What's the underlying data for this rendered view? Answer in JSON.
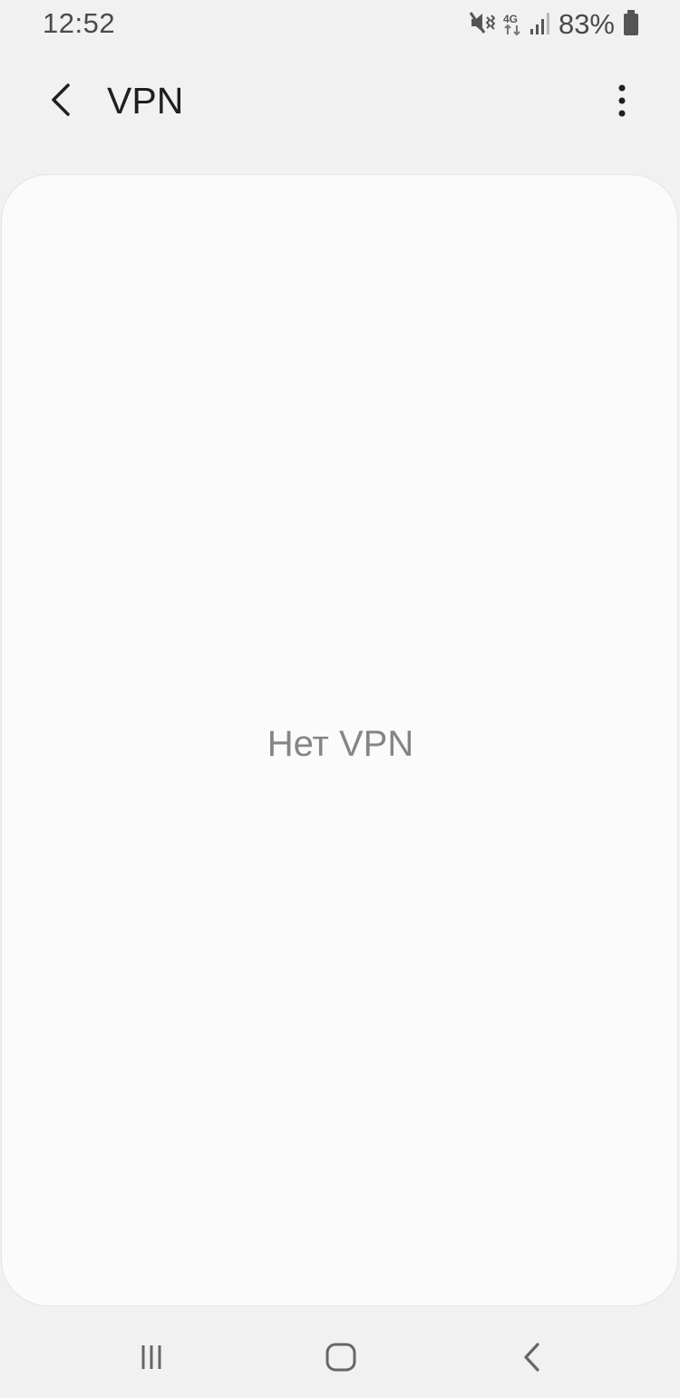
{
  "status_bar": {
    "time": "12:52",
    "battery_percent": "83%",
    "network_type": "4G",
    "icons": [
      "mute-vibrate-icon",
      "data-arrows-icon",
      "signal-icon",
      "battery-icon"
    ]
  },
  "app_bar": {
    "title": "VPN",
    "back_icon": "chevron-left-icon",
    "more_icon": "more-vertical-icon"
  },
  "content": {
    "empty_message": "Нет VPN"
  },
  "navigation": {
    "recent_icon": "recent-apps-icon",
    "home_icon": "home-icon",
    "back_icon": "nav-back-icon"
  },
  "colors": {
    "background": "#f1f1f1",
    "card": "#fbfbfb",
    "text_primary": "#1f1f1f",
    "text_secondary": "#858585"
  }
}
